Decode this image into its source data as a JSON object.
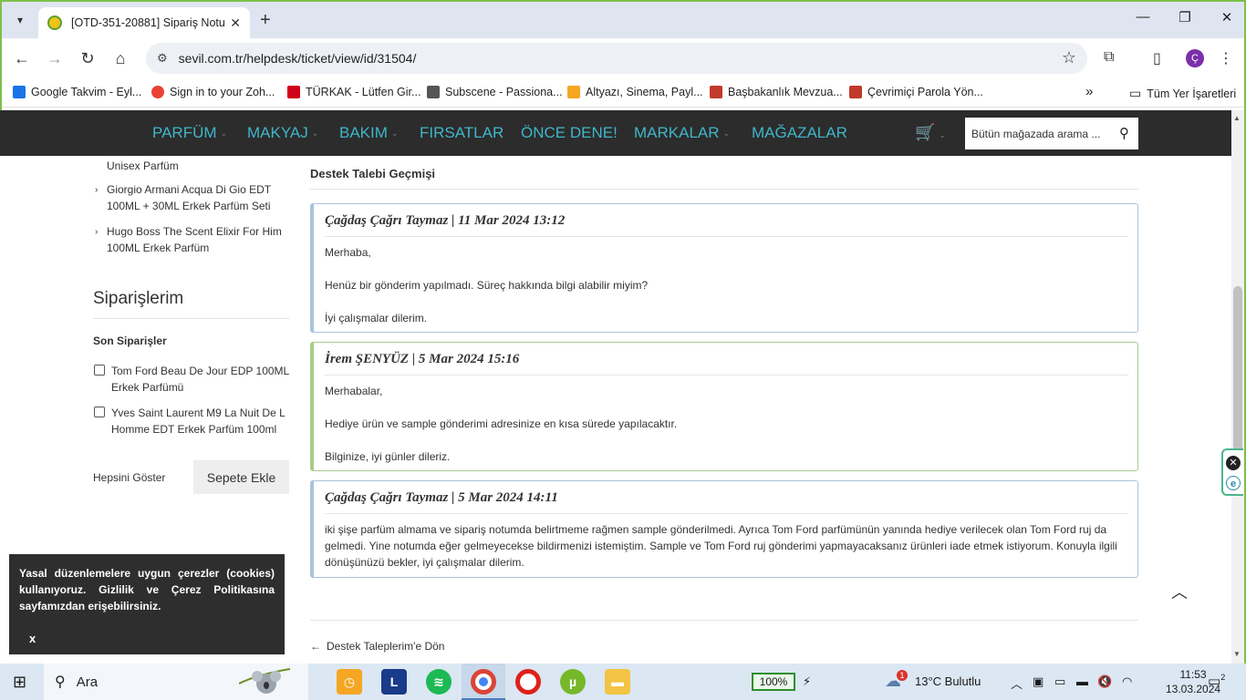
{
  "browser": {
    "tab_title": "[OTD-351-20881] Sipariş Notu",
    "tab_close": "✕",
    "new_tab": "+",
    "url": "sevil.com.tr/helpdesk/ticket/view/id/31504/",
    "bookmarks": [
      {
        "label": "Google Takvim - Eyl...",
        "color": "#1a73e8"
      },
      {
        "label": "Sign in to your Zoh...",
        "color": "#e94235"
      },
      {
        "label": "TÜRKAK - Lütfen Gir...",
        "color": "#d0021b"
      },
      {
        "label": "Subscene - Passiona...",
        "color": "#555555"
      },
      {
        "label": "Altyazı, Sinema, Payl...",
        "color": "#f5a623"
      },
      {
        "label": "Başbakanlık Mevzua...",
        "color": "#c0392b"
      },
      {
        "label": "Çevrimiçi Parola Yön...",
        "color": "#c0392b"
      }
    ],
    "bookmarks_more": "»",
    "all_bookmarks": "Tüm Yer İşaretleri",
    "profile_initial": "Ç"
  },
  "site": {
    "nav": [
      {
        "label": "PARFÜM",
        "chevron": true
      },
      {
        "label": "MAKYAJ",
        "chevron": true
      },
      {
        "label": "BAKIM",
        "chevron": true
      },
      {
        "label": "FIRSATLAR",
        "chevron": false
      },
      {
        "label": "ÖNCE DENE!",
        "chevron": false
      },
      {
        "label": "MARKALAR",
        "chevron": true
      },
      {
        "label": "MAĞAZALAR",
        "chevron": false
      }
    ],
    "search_placeholder": "Bütün mağazada arama ...",
    "accent": "#3fb6c8"
  },
  "sidebar": {
    "partial_item": "Unisex Parfüm",
    "items": [
      "Giorgio Armani Acqua Di Gio EDT 100ML + 30ML Erkek Parfüm Seti",
      "Hugo Boss The Scent Elixir For Him 100ML Erkek Parfüm"
    ],
    "orders_title": "Siparişlerim",
    "recent_title": "Son Siparişler",
    "orders": [
      "Tom Ford Beau De Jour EDP 100ML Erkek Parfümü",
      "Yves Saint Laurent M9 La Nuit De L Homme EDT Erkek Parfüm 100ml"
    ],
    "show_all": "Hepsini Göster",
    "add_to_cart": "Sepete Ekle"
  },
  "ticket": {
    "history_title": "Destek Talebi Geçmişi",
    "messages": [
      {
        "header": "Çağdaş Çağrı Taymaz | 11 Mar 2024 13:12",
        "lines": [
          "Merhaba,",
          "Henüz bir gönderim yapılmadı. Süreç hakkında bilgi alabilir miyim?",
          "İyi çalışmalar dilerim."
        ]
      },
      {
        "header": "İrem ŞENYÜZ | 5 Mar 2024 15:16",
        "lines": [
          "Merhabalar,",
          "Hediye ürün ve sample gönderimi adresinize en kısa sürede yapılacaktır.",
          "Bilginize, iyi günler dileriz."
        ]
      },
      {
        "header": "Çağdaş Çağrı Taymaz | 5 Mar 2024 14:11",
        "lines": [
          "iki şişe parfüm almama ve sipariş notumda belirtmeme rağmen sample gönderilmedi. Ayrıca Tom Ford parfümünün yanında hediye verilecek olan Tom Ford ruj da gelmedi. Yine notumda eğer gelmeyecekse bildirmenizi istemiştim. Sample ve Tom Ford ruj gönderimi yapmayacaksanız ürünleri iade etmek istiyorum. Konuyla ilgili dönüşünüzü bekler, iyi çalışmalar dilerim."
        ]
      }
    ],
    "back_link": "Destek Taleplerim'e Dön"
  },
  "cookie": {
    "text": "Yasal düzenlemelere uygun çerezler (cookies) kullanıyoruz. Gizlilik ve Çerez Politikasına sayfamızdan erişebilirsiniz.",
    "close": "x"
  },
  "taskbar": {
    "search_label": "Ara",
    "battery": "100%",
    "weather": "13°C  Bulutlu",
    "weather_badge": "1",
    "time": "11:53",
    "date": "13.03.2024",
    "notif_count": "2"
  }
}
